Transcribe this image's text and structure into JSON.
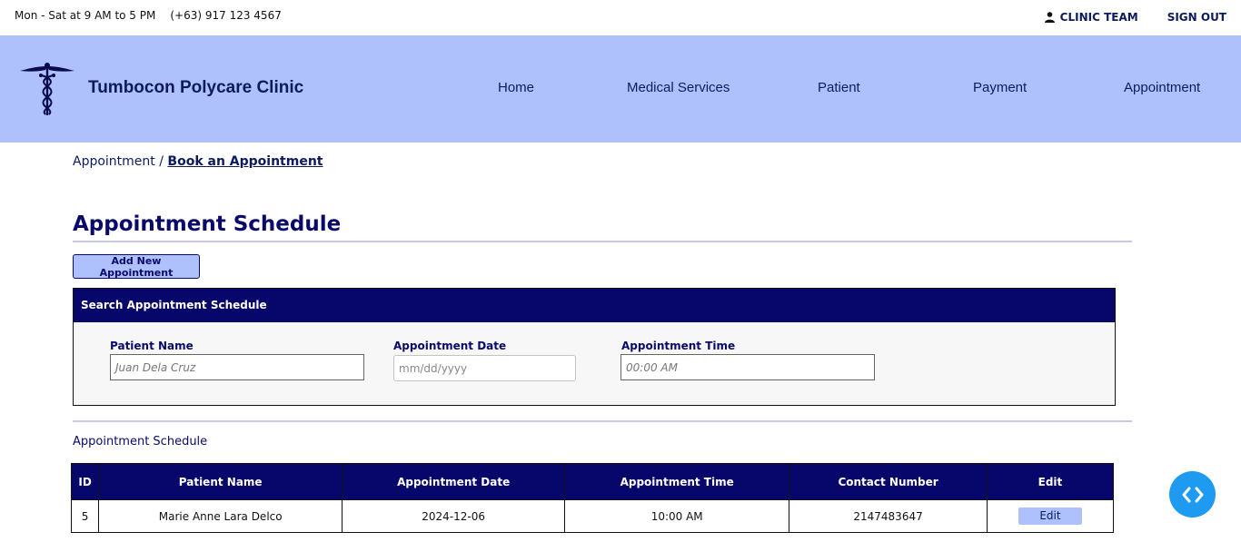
{
  "topbar": {
    "hours": "Mon - Sat at 9 AM to 5 PM",
    "phone": "(+63) 917 123 4567",
    "team_label": "CLINIC TEAM",
    "signout_label": "SIGN OUT"
  },
  "header": {
    "brand": "Tumbocon Polycare Clinic",
    "nav": [
      "Home",
      "Medical Services",
      "Patient",
      "Payment",
      "Appointment"
    ]
  },
  "breadcrumb": {
    "parent": "Appointment",
    "separator": "/",
    "current": "Book an Appointment"
  },
  "page": {
    "title": "Appointment Schedule",
    "add_button": "Add New Appointment"
  },
  "search": {
    "heading": "Search Appointment Schedule",
    "fields": [
      {
        "label": "Patient Name",
        "placeholder": "Juan Dela Cruz"
      },
      {
        "label": "Appointment Date",
        "placeholder": "mm/dd/yyyy"
      },
      {
        "label": "Appointment Time",
        "placeholder": "00:00 AM"
      }
    ]
  },
  "schedule": {
    "section_label": "Appointment Schedule",
    "columns": [
      "ID",
      "Patient Name",
      "Appointment Date",
      "Appointment Time",
      "Contact Number",
      "Edit"
    ],
    "rows": [
      {
        "id": "5",
        "patient_name": "Marie Anne Lara Delco",
        "date": "2024-12-06",
        "time": "10:00 AM",
        "contact": "2147483647",
        "edit_label": "Edit"
      }
    ]
  },
  "colors": {
    "header_bg": "#aec1fd",
    "navy": "#06066b",
    "fab": "#1e9bf0"
  },
  "icons": [
    "user-icon",
    "caduceus-logo-icon",
    "code-brackets-icon"
  ]
}
